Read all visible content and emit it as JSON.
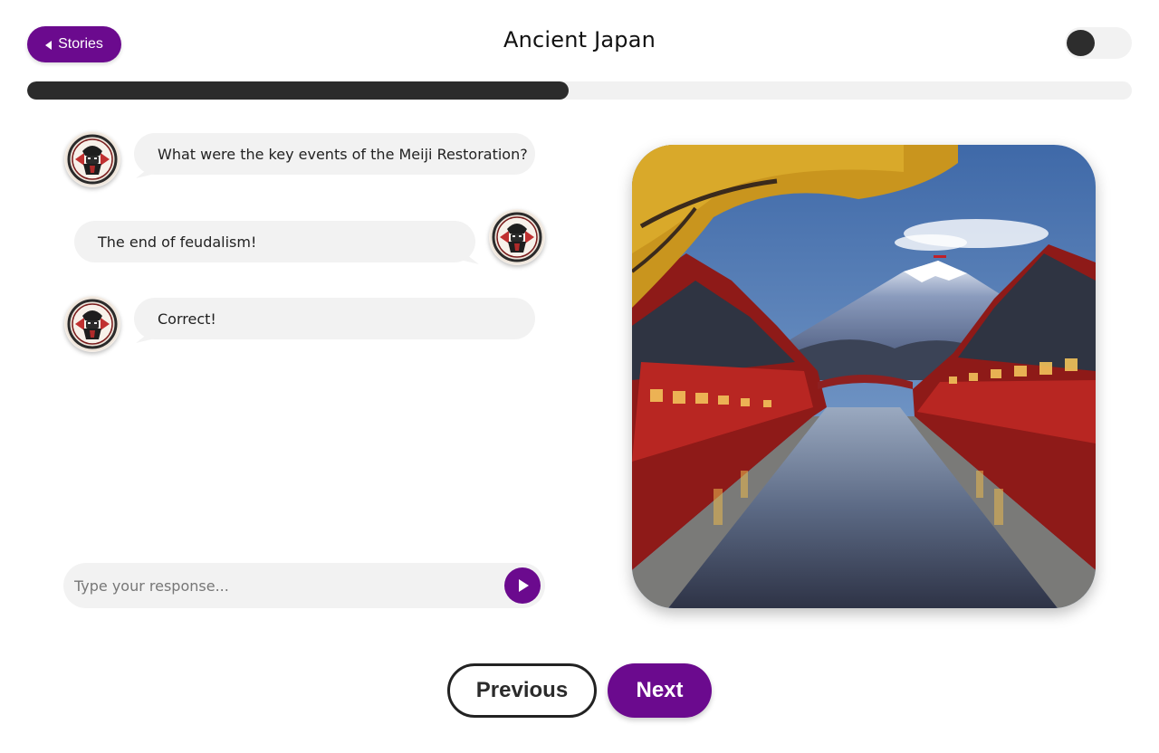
{
  "header": {
    "back_label": "Stories",
    "title": "Ancient Japan",
    "theme_toggle": "off"
  },
  "progress": {
    "fraction": 0.49
  },
  "chat": {
    "messages": [
      {
        "sender": "bot",
        "text": "What were the key events of the Meiji Restoration?"
      },
      {
        "sender": "user",
        "text": "The end of feudalism!"
      },
      {
        "sender": "bot",
        "text": "Correct!"
      }
    ],
    "input_placeholder": "Type your response...",
    "input_value": ""
  },
  "scene": {
    "icon": "japanese-canal-with-mount-fuji-image"
  },
  "footer": {
    "previous_label": "Previous",
    "next_label": "Next"
  },
  "colors": {
    "accent": "#6b0a8e",
    "dark": "#2b2b2b",
    "bubble": "#f2f2f2"
  }
}
